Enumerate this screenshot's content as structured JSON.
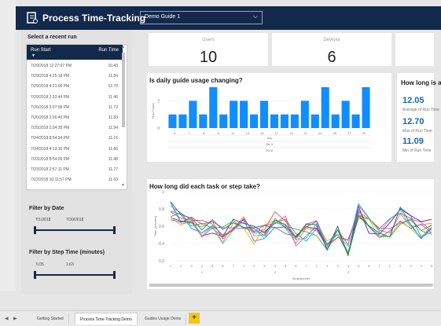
{
  "header": {
    "title": "Process Time-Tracking",
    "guide_selected": "Demo Guide 1"
  },
  "runs": {
    "title": "Select a recent run",
    "col_start": "Run Start",
    "col_time": "Run Time",
    "rows": [
      {
        "start": "7/29/2018 12:27:07 PM",
        "time": "10.43"
      },
      {
        "start": "7/29/2018 4:25:18 PM",
        "time": "11.84"
      },
      {
        "start": "7/29/2018 4:21:06 PM",
        "time": "12.70"
      },
      {
        "start": "7/29/2018 2:32:44 PM",
        "time": "11.46"
      },
      {
        "start": "7/26/2018 3:07:08 PM",
        "time": "11.73"
      },
      {
        "start": "7/26/2018 2:06:40 PM",
        "time": "11.83"
      },
      {
        "start": "7/25/2018 2:34:28 PM",
        "time": "11.94"
      },
      {
        "start": "7/24/2018 8:54:34 PM",
        "time": "11.16"
      },
      {
        "start": "7/24/2018 4:13:16 PM",
        "time": "11.86"
      },
      {
        "start": "7/23/2018 8:54:05 PM",
        "time": "11.48"
      },
      {
        "start": "7/23/2018 2:57:11 PM",
        "time": "11.77"
      },
      {
        "start": "7/22/2018 10:11:57 PM",
        "time": "11.63"
      }
    ]
  },
  "filter_date": {
    "title": "Filter by Date",
    "from": "7/1/2018",
    "to": "7/30/2018",
    "range_fraction": [
      0,
      1
    ]
  },
  "filter_step": {
    "title": "Filter by Step Time (minutes)",
    "min": "0.05",
    "max": "1.63",
    "range_fraction": [
      0,
      1
    ]
  },
  "kpis": {
    "users_label": "Users",
    "users_value": "10",
    "devices_label": "Devices",
    "devices_value": "6"
  },
  "usage_chart": {
    "title": "Is daily guide usage changing?"
  },
  "how_long": {
    "title": "How long is a",
    "stats": [
      {
        "value": "12.05",
        "label": "Average of Run Time"
      },
      {
        "value": "12.70",
        "label": "Max of Run Time"
      },
      {
        "value": "11.09",
        "label": "Min of Run Time"
      }
    ]
  },
  "task_chart": {
    "title": "How long did each task or step take?"
  },
  "tabs": [
    {
      "label": "Getting Started",
      "active": false
    },
    {
      "label": "Process Time-Tracking Demo",
      "active": true
    },
    {
      "label": "Guides Usage Demo",
      "active": false
    }
  ],
  "add_tab_label": "+",
  "colors": {
    "navy": "#13294b",
    "bar_blue": "#118dff",
    "stat_blue": "#1a66b5",
    "accent_yellow": "#f2c811"
  },
  "chart_data": [
    {
      "type": "bar",
      "title": "Is daily guide usage changing?",
      "ylabel": "Run Count",
      "xlabel": "",
      "ylim": [
        0,
        3
      ],
      "yticks": [
        0,
        2
      ],
      "categories": [
        "1",
        "2",
        "3",
        "4",
        "5",
        "6",
        "7",
        "8",
        "9",
        "10",
        "11",
        "12",
        "13",
        "14",
        "15",
        "16",
        "17",
        "18",
        "19",
        "20",
        "21",
        "22",
        "23",
        "24",
        "25",
        "26",
        "27",
        "28",
        "29",
        "30"
      ],
      "tick_labels": [
        "6",
        "7",
        "8",
        "9",
        "11",
        "13",
        "15",
        "17",
        "19",
        "21",
        "23",
        "25",
        "27",
        "29"
      ],
      "values": [
        1,
        1,
        2,
        1,
        3,
        1,
        2,
        2,
        1,
        2,
        1,
        1,
        1,
        2,
        1,
        3,
        1,
        2,
        1,
        3
      ],
      "group_labels": [
        "July",
        "Qtr 3",
        "2018"
      ]
    },
    {
      "type": "line",
      "title": "How long did each task or step take?",
      "xlabel": "StepNumber",
      "ylabel": "Time (minutes)",
      "ylim": [
        0.2,
        1.0
      ],
      "yticks": [
        0.2,
        0.4,
        0.6,
        0.8,
        1.0
      ],
      "x": [
        1,
        2,
        3,
        4,
        5,
        6,
        7,
        1,
        2,
        3,
        4,
        5,
        6,
        7,
        1,
        2,
        3,
        4,
        5,
        6,
        7,
        1,
        2,
        3,
        4,
        5
      ],
      "x_groups": [
        "1",
        "2",
        "3"
      ],
      "series_count": 10,
      "colors": [
        "#118dff",
        "#e66c37",
        "#6b007b",
        "#e044a7",
        "#744ec2",
        "#d9b300",
        "#d64550",
        "#197278",
        "#1aab40",
        "#15c6f4"
      ]
    }
  ]
}
